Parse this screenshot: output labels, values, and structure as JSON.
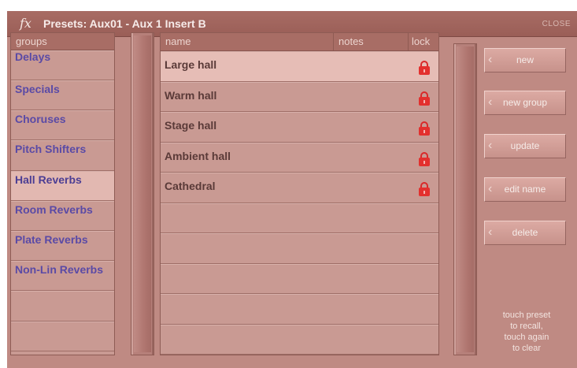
{
  "window": {
    "fx_label": "fx",
    "title": "Presets: Aux01 - Aux 1 Insert B",
    "close_label": "CLOSE"
  },
  "groups": {
    "header": "groups",
    "items": [
      {
        "label": "Delays",
        "selected": false
      },
      {
        "label": "Specials",
        "selected": false
      },
      {
        "label": "Choruses",
        "selected": false
      },
      {
        "label": "Pitch Shifters",
        "selected": false
      },
      {
        "label": "Hall Reverbs",
        "selected": true
      },
      {
        "label": "Room Reverbs",
        "selected": false
      },
      {
        "label": "Plate Reverbs",
        "selected": false
      },
      {
        "label": "Non-Lin Reverbs",
        "selected": false
      },
      {
        "label": "",
        "selected": false
      },
      {
        "label": "",
        "selected": false
      }
    ]
  },
  "presets": {
    "columns": {
      "name": "name",
      "notes": "notes",
      "lock": "lock"
    },
    "rows": [
      {
        "name": "Large hall",
        "locked": true,
        "selected": true
      },
      {
        "name": "Warm hall",
        "locked": true,
        "selected": false
      },
      {
        "name": "Stage hall",
        "locked": true,
        "selected": false
      },
      {
        "name": "Ambient hall",
        "locked": true,
        "selected": false
      },
      {
        "name": "Cathedral",
        "locked": true,
        "selected": false
      },
      {
        "name": "",
        "locked": false,
        "selected": false
      },
      {
        "name": "",
        "locked": false,
        "selected": false
      },
      {
        "name": "",
        "locked": false,
        "selected": false
      },
      {
        "name": "",
        "locked": false,
        "selected": false
      },
      {
        "name": "",
        "locked": false,
        "selected": false
      }
    ]
  },
  "buttons": {
    "new": "new",
    "new_group": "new group",
    "update": "update",
    "edit_name": "edit name",
    "delete": "delete"
  },
  "hint": {
    "line1": "touch preset",
    "line2": "to recall,",
    "line3": "touch again",
    "line4": "to clear"
  },
  "icons": {
    "lock": "padlock-icon",
    "button_chevron": "chevron-left-icon"
  },
  "colors": {
    "panel": "#bf8a83",
    "title_bar": "#9a5e57",
    "group_text": "#5a4aa6",
    "lock_red": "#e3302e"
  }
}
